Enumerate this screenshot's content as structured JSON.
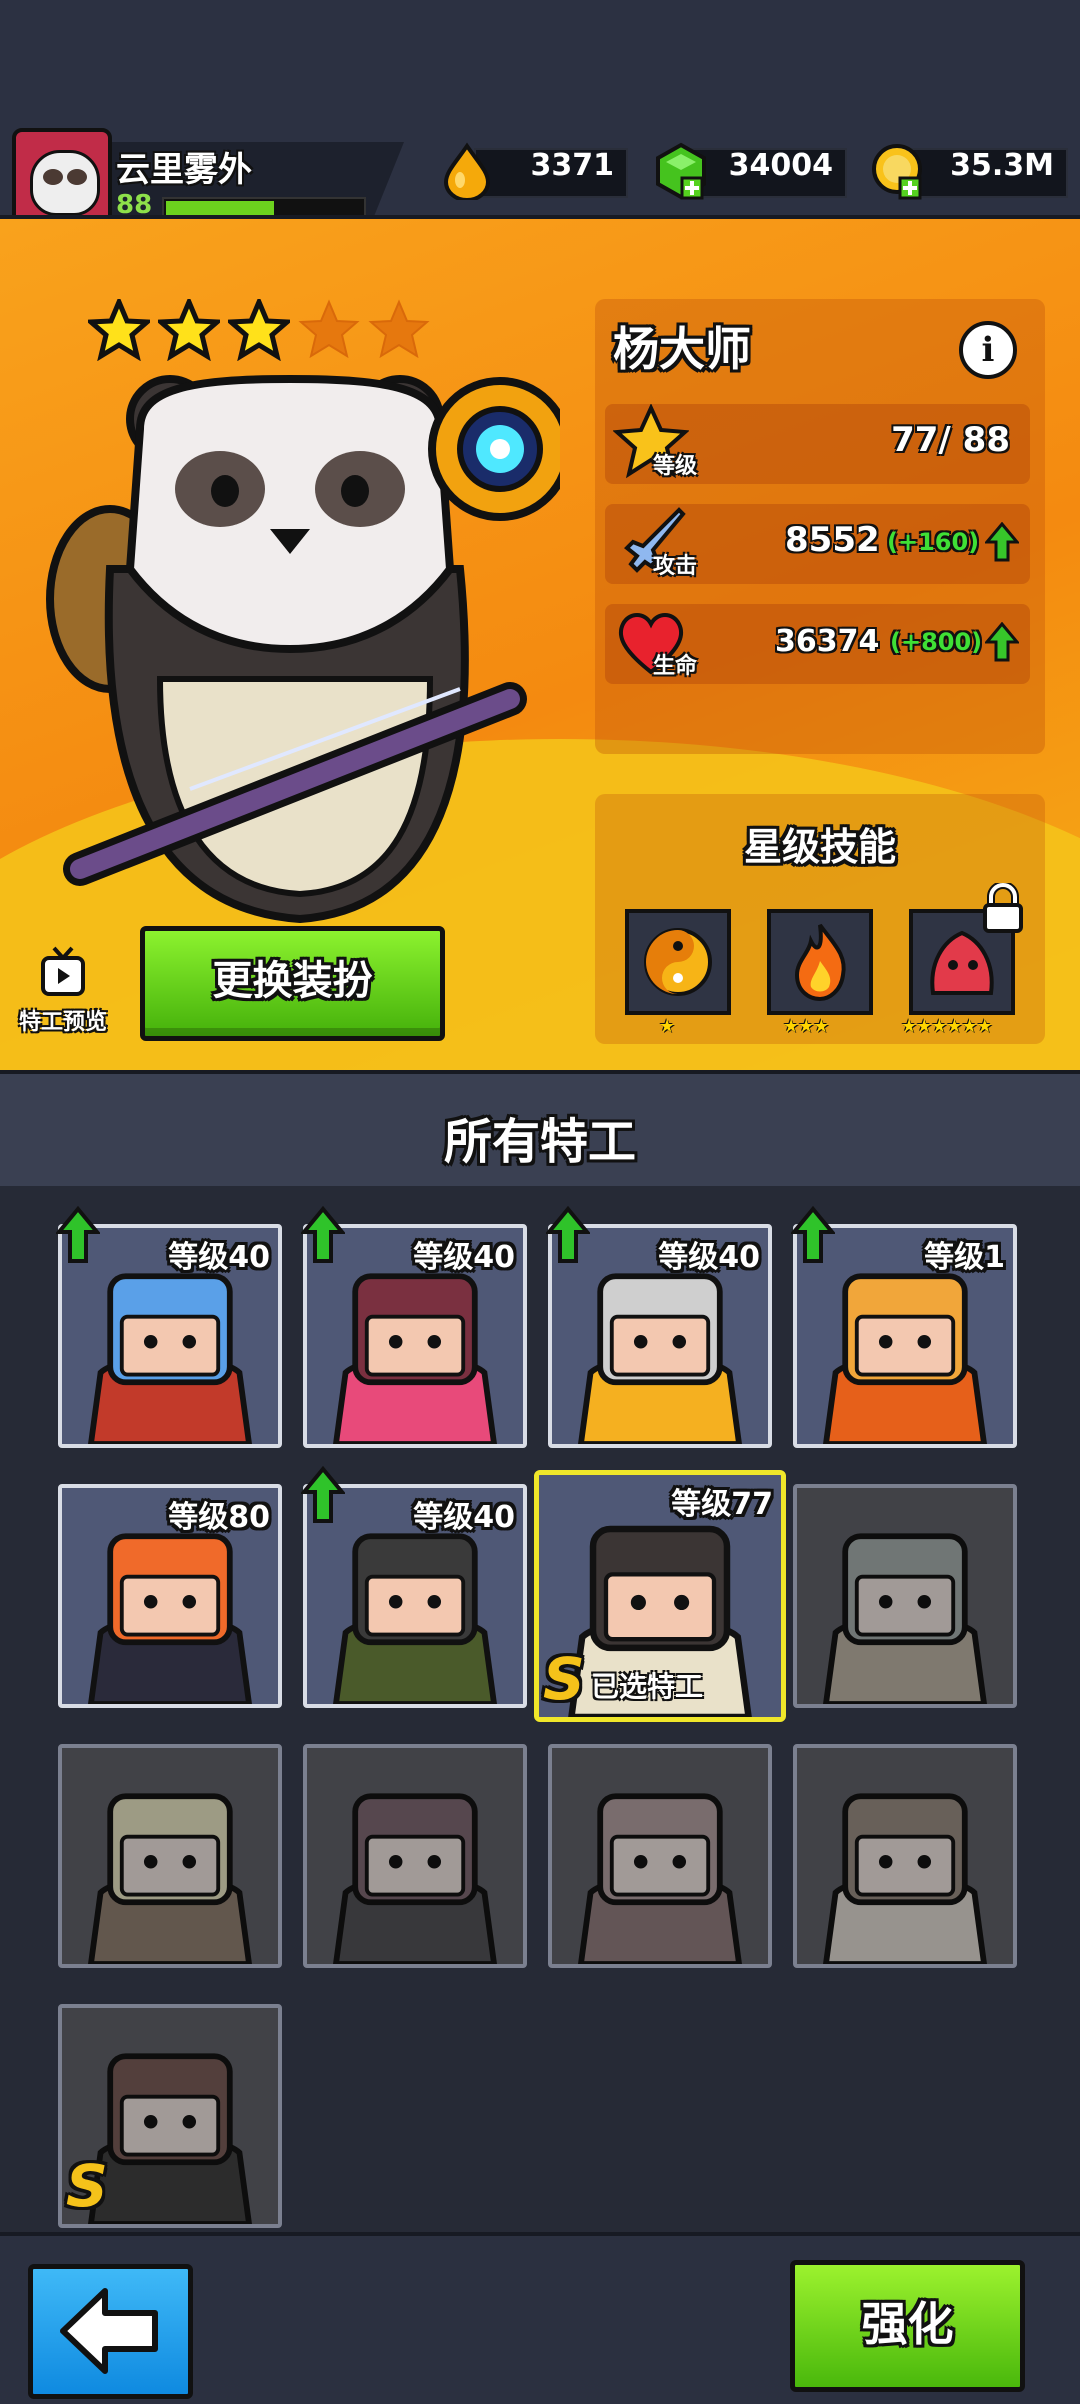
{
  "player": {
    "name": "云里雾外",
    "level": "88",
    "xp_fraction": 0.55
  },
  "resources": [
    {
      "icon": "energy-drop-icon",
      "value": "3371"
    },
    {
      "icon": "green-gem-icon",
      "value": "34004"
    },
    {
      "icon": "gold-coin-icon",
      "value": "35.3M"
    }
  ],
  "hero": {
    "name": "杨大师",
    "stars_filled": 3,
    "stars_total": 5,
    "level_label": "等级",
    "level_value": "77/ 88",
    "attack_label": "攻击",
    "attack_value": "8552",
    "attack_bonus": "(+160)",
    "hp_label": "生命",
    "hp_value": "36374",
    "hp_bonus": "(+800)"
  },
  "skills": {
    "title": "星级技能",
    "items": [
      {
        "icon": "yin-yang-icon",
        "stars": "★",
        "locked": false
      },
      {
        "icon": "fire-icon",
        "stars": "★★★",
        "locked": false
      },
      {
        "icon": "red-spirit-icon",
        "stars": "★★★★★★",
        "locked": true
      }
    ]
  },
  "buttons": {
    "preview": "特工预览",
    "change_outfit": "更换装扮",
    "upgrade": "强化"
  },
  "section_title": "所有特工",
  "agents": [
    {
      "level": "等级40",
      "upgrade": true
    },
    {
      "level": "等级40",
      "upgrade": true
    },
    {
      "level": "等级40",
      "upgrade": true
    },
    {
      "level": "等级1",
      "upgrade": true
    },
    {
      "level": "等级80",
      "upgrade": false
    },
    {
      "level": "等级40",
      "upgrade": true
    },
    {
      "level": "等级77",
      "upgrade": false,
      "selected": true,
      "selected_label": "已选特工",
      "rank": "S"
    },
    {
      "locked": true
    },
    {
      "locked": true
    },
    {
      "locked": true
    },
    {
      "locked": true
    },
    {
      "locked": true
    },
    {
      "locked": true,
      "rank": "S"
    }
  ],
  "colors": {
    "accent_green": "#6cd21e",
    "banner_orange": "#f48a10",
    "selected_yellow": "#f0e72a",
    "back_blue": "#0f8ae0"
  }
}
